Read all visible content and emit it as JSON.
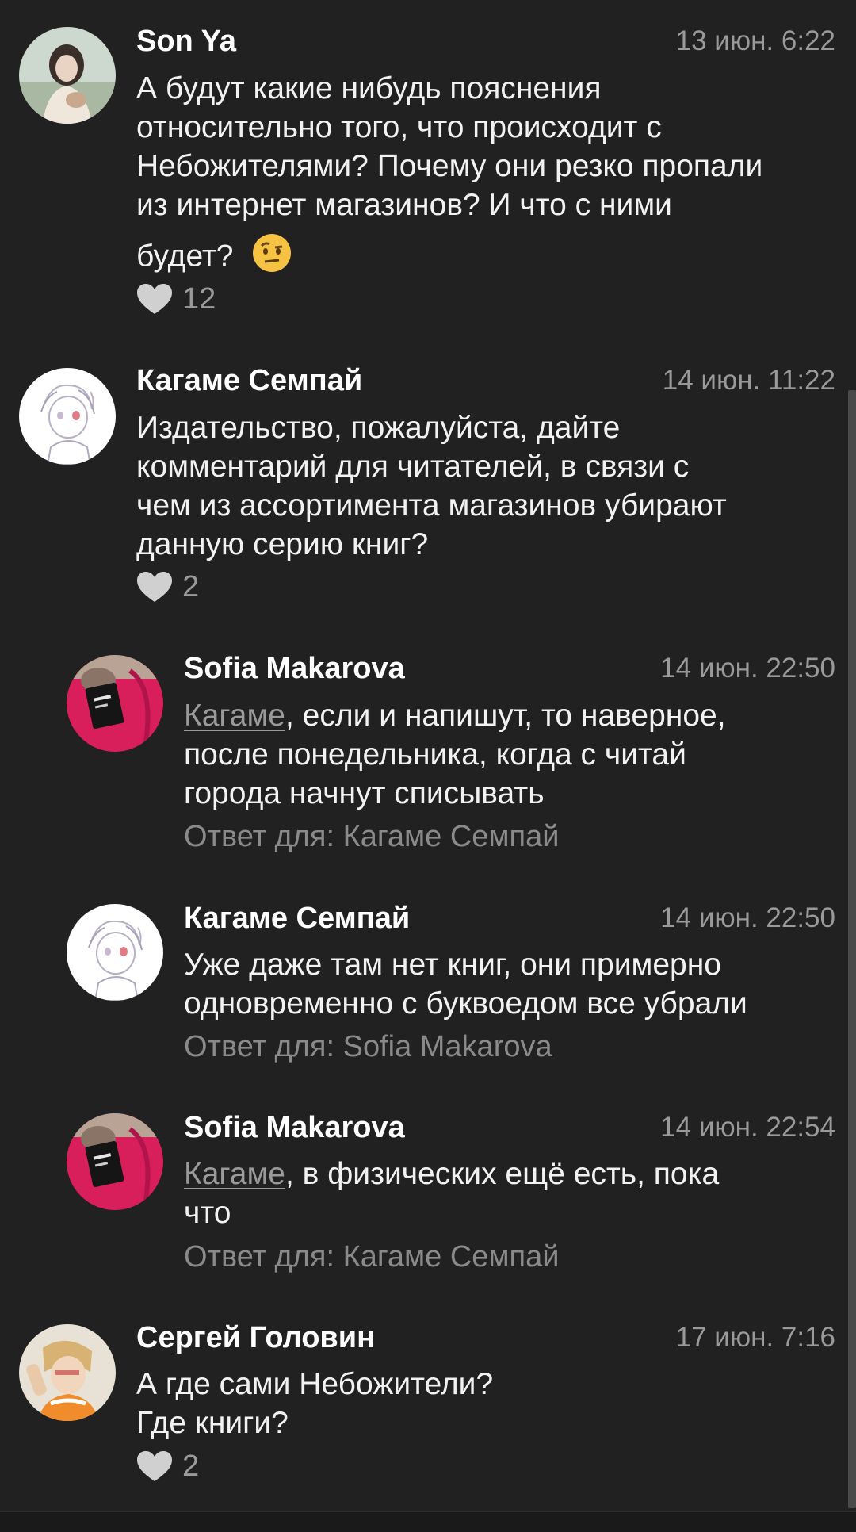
{
  "comments": [
    {
      "author": "Son Ya",
      "date": "13 июн. 6:22",
      "lines": [
        "А будут какие нибудь пояснения",
        "относительно того, что происходит с",
        "Небожителями? Почему они резко пропали",
        "из интернет магазинов? И что с ними"
      ],
      "last_line": "будет?",
      "emoji": "raised-eyebrow-emoji",
      "likes": "12"
    },
    {
      "author": "Кагаме Семпай",
      "date": "14 июн. 11:22",
      "lines": [
        "Издательство, пожалуйста, дайте",
        "комментарий для читателей, в связи с",
        "чем из ассортимента магазинов убирают",
        "данную серию книг?"
      ],
      "likes": "2"
    },
    {
      "author": "Sofia Makarova",
      "date": "14 июн. 22:50",
      "mention": "Кагаме",
      "first_line_rest": ", если и напишут, то наверное,",
      "lines": [
        "после понедельника, когда с читай",
        "города начнут списывать"
      ],
      "reply_to": "Ответ для: Кагаме Семпай"
    },
    {
      "author": "Кагаме Семпай",
      "date": "14 июн. 22:50",
      "lines": [
        "Уже даже там нет книг,  они примерно",
        "одновременно с буквоедом все убрали"
      ],
      "reply_to": "Ответ для: Sofia Makarova"
    },
    {
      "author": "Sofia Makarova",
      "date": "14 июн. 22:54",
      "mention": "Кагаме",
      "first_line_rest": ", в физических ещё есть, пока",
      "lines": [
        "что"
      ],
      "reply_to": "Ответ для: Кагаме Семпай"
    },
    {
      "author": "Сергей Головин",
      "date": "17 июн. 7:16",
      "lines": [
        "А где сами Небожители?",
        "Где книги?"
      ],
      "likes": "2"
    }
  ],
  "icons": {
    "like": "heart-icon",
    "avatar_sonya": "avatar-girl-photo",
    "avatar_kagame": "avatar-anime-sketch",
    "avatar_sofia": "avatar-book-red-sweater",
    "avatar_sergey": "avatar-illustration-orange"
  },
  "colors": {
    "background": "#212121",
    "text": "#f2f2f2",
    "secondary": "#9a9a9a",
    "heart": "#d0d0d0"
  }
}
